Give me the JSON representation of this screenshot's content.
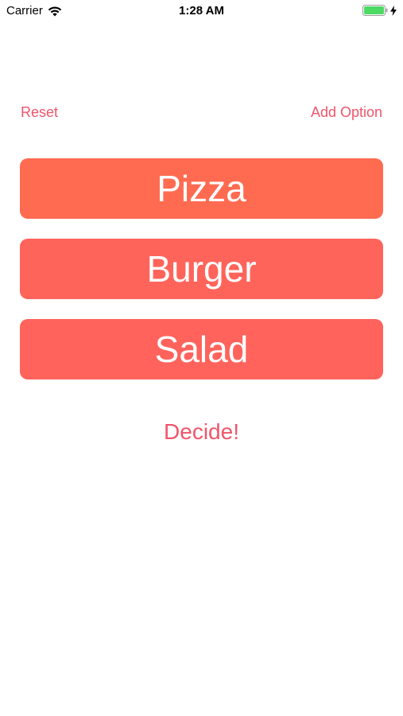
{
  "status_bar": {
    "carrier": "Carrier",
    "time": "1:28 AM",
    "battery_color": "#4cd964"
  },
  "nav": {
    "reset_label": "Reset",
    "add_option_label": "Add Option",
    "accent_color": "#f0556b"
  },
  "options": [
    {
      "label": "Pizza",
      "color": "#ff6b51"
    },
    {
      "label": "Burger",
      "color": "#ff645b"
    },
    {
      "label": "Salad",
      "color": "#ff635c"
    }
  ],
  "decide_label": "Decide!"
}
